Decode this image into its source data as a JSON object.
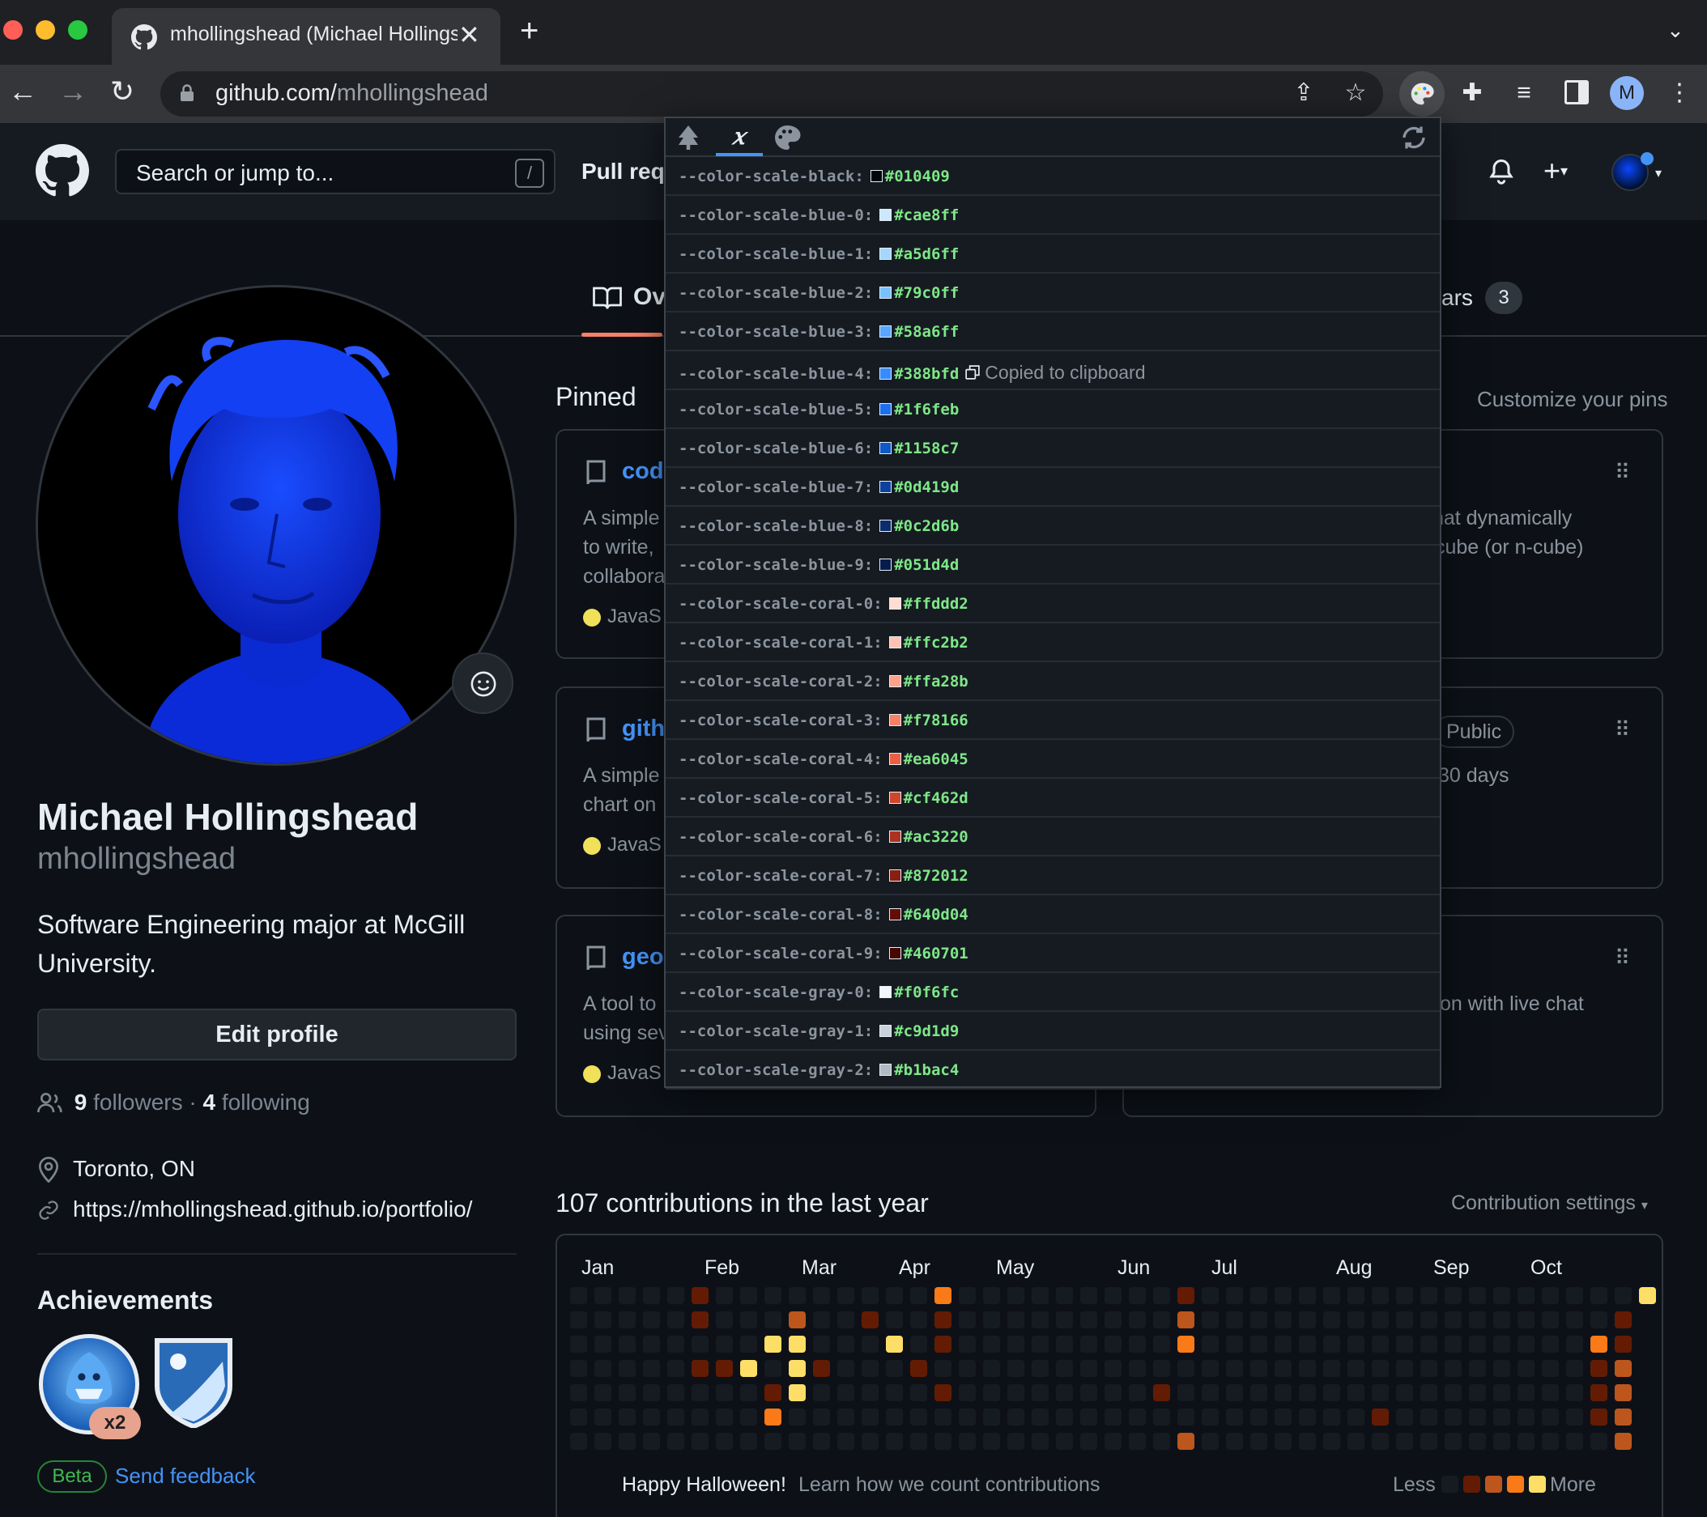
{
  "browser": {
    "tab_title": "mhollingshead (Michael Hollingshead)",
    "url_host": "github.com/",
    "url_path": "mhollingshead",
    "profile_initial": "M"
  },
  "gh_header": {
    "search_placeholder": "Search or jump to...",
    "search_shortcut": "/",
    "pull_requests": "Pull req"
  },
  "profile_tabs": {
    "overview": "Ov",
    "stars": "ars",
    "stars_count": "3"
  },
  "profile": {
    "full_name": "Michael Hollingshead",
    "login": "mhollingshead",
    "bio": "Software Engineering major at McGill University.",
    "edit_button": "Edit profile",
    "followers_count": "9",
    "followers_label": "followers",
    "following_count": "4",
    "following_label": "following",
    "location": "Toronto, ON",
    "website": "https://mhollingshead.github.io/portfolio/",
    "achievements_title": "Achievements",
    "badge_multiplier": "x2",
    "beta": "Beta",
    "feedback": "Send feedback"
  },
  "pinned": {
    "title": "Pinned",
    "customize": "Customize your pins",
    "public_badge": "Public",
    "cards": [
      {
        "name": "cod",
        "desc": [
          "A simple",
          "to write,",
          "collabora"
        ],
        "lang": "JavaS"
      },
      {
        "name": "",
        "desc": [
          "that dynamically",
          "cube (or n-cube)"
        ],
        "lang": ""
      },
      {
        "name": "gith",
        "desc": [
          "A simple",
          "chart on"
        ],
        "lang": "JavaS"
      },
      {
        "name": "",
        "desc": [
          "30 days"
        ],
        "lang": ""
      },
      {
        "name": "geo",
        "desc": [
          "A tool to",
          "using sev"
        ],
        "lang": "JavaS"
      },
      {
        "name": "",
        "desc": [
          "on with live chat"
        ],
        "lang": ""
      }
    ]
  },
  "contributions": {
    "title": "107 contributions in the last year",
    "settings": "Contribution settings",
    "months": [
      "Jan",
      "Feb",
      "Mar",
      "Apr",
      "May",
      "Jun",
      "Jul",
      "Aug",
      "Sep",
      "Oct"
    ],
    "halloween": "Happy Halloween!",
    "learn": "Learn how we count contributions",
    "less": "Less",
    "more": "More",
    "legend_colors": [
      "#161b22",
      "#631c03",
      "#bd561d",
      "#fa7a18",
      "#fddf68"
    ],
    "weeks": 45,
    "active_cells": [
      [
        5,
        0,
        1
      ],
      [
        5,
        1,
        1
      ],
      [
        5,
        3,
        1
      ],
      [
        6,
        3,
        1
      ],
      [
        7,
        3,
        4
      ],
      [
        8,
        2,
        4
      ],
      [
        8,
        4,
        1
      ],
      [
        8,
        5,
        3
      ],
      [
        9,
        1,
        2
      ],
      [
        9,
        2,
        4
      ],
      [
        9,
        3,
        4
      ],
      [
        9,
        4,
        4
      ],
      [
        10,
        3,
        1
      ],
      [
        12,
        1,
        1
      ],
      [
        13,
        2,
        4
      ],
      [
        14,
        3,
        1
      ],
      [
        15,
        0,
        3
      ],
      [
        15,
        1,
        1
      ],
      [
        15,
        2,
        1
      ],
      [
        15,
        4,
        1
      ],
      [
        24,
        4,
        1
      ],
      [
        25,
        0,
        1
      ],
      [
        25,
        1,
        2
      ],
      [
        25,
        2,
        3
      ],
      [
        25,
        6,
        2
      ],
      [
        33,
        5,
        1
      ],
      [
        42,
        2,
        3
      ],
      [
        42,
        3,
        1
      ],
      [
        42,
        4,
        1
      ],
      [
        42,
        5,
        1
      ],
      [
        43,
        1,
        1
      ],
      [
        43,
        2,
        1
      ],
      [
        43,
        3,
        2
      ],
      [
        43,
        4,
        2
      ],
      [
        43,
        5,
        2
      ],
      [
        43,
        6,
        2
      ],
      [
        44,
        0,
        4
      ]
    ]
  },
  "css_vars_popup": {
    "copied_text": "Copied to clipboard",
    "vars": [
      {
        "name": "--color-scale-black:",
        "value": "#010409"
      },
      {
        "name": "--color-scale-blue-0:",
        "value": "#cae8ff"
      },
      {
        "name": "--color-scale-blue-1:",
        "value": "#a5d6ff"
      },
      {
        "name": "--color-scale-blue-2:",
        "value": "#79c0ff"
      },
      {
        "name": "--color-scale-blue-3:",
        "value": "#58a6ff"
      },
      {
        "name": "--color-scale-blue-4:",
        "value": "#388bfd",
        "copied": true
      },
      {
        "name": "--color-scale-blue-5:",
        "value": "#1f6feb"
      },
      {
        "name": "--color-scale-blue-6:",
        "value": "#1158c7"
      },
      {
        "name": "--color-scale-blue-7:",
        "value": "#0d419d"
      },
      {
        "name": "--color-scale-blue-8:",
        "value": "#0c2d6b"
      },
      {
        "name": "--color-scale-blue-9:",
        "value": "#051d4d"
      },
      {
        "name": "--color-scale-coral-0:",
        "value": "#ffddd2"
      },
      {
        "name": "--color-scale-coral-1:",
        "value": "#ffc2b2"
      },
      {
        "name": "--color-scale-coral-2:",
        "value": "#ffa28b"
      },
      {
        "name": "--color-scale-coral-3:",
        "value": "#f78166"
      },
      {
        "name": "--color-scale-coral-4:",
        "value": "#ea6045"
      },
      {
        "name": "--color-scale-coral-5:",
        "value": "#cf462d"
      },
      {
        "name": "--color-scale-coral-6:",
        "value": "#ac3220"
      },
      {
        "name": "--color-scale-coral-7:",
        "value": "#872012"
      },
      {
        "name": "--color-scale-coral-8:",
        "value": "#640d04"
      },
      {
        "name": "--color-scale-coral-9:",
        "value": "#460701"
      },
      {
        "name": "--color-scale-gray-0:",
        "value": "#f0f6fc"
      },
      {
        "name": "--color-scale-gray-1:",
        "value": "#c9d1d9"
      },
      {
        "name": "--color-scale-gray-2:",
        "value": "#b1bac4"
      }
    ]
  }
}
